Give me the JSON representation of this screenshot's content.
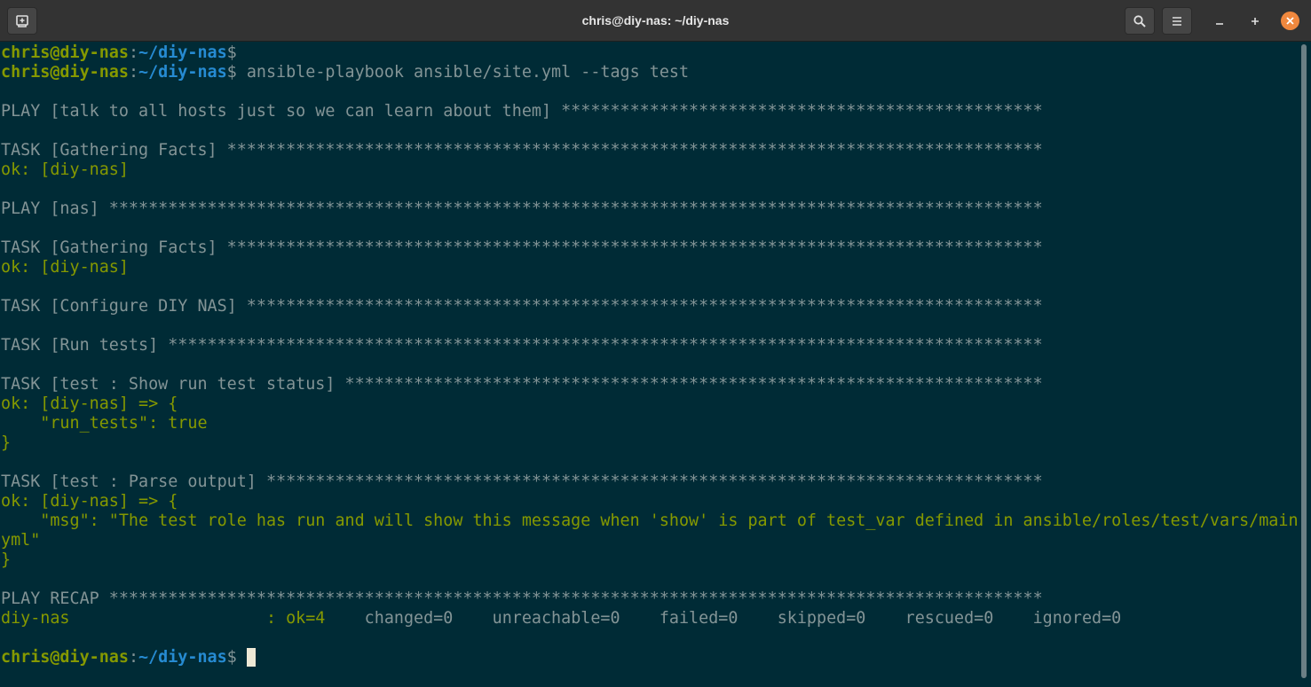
{
  "window": {
    "title": "chris@diy-nas: ~/diy-nas"
  },
  "icons": {
    "new_tab": "new-tab-icon",
    "search": "search-icon",
    "menu": "hamburger-menu-icon",
    "minimize": "minimize-icon",
    "maximize": "maximize-icon",
    "close": "close-icon"
  },
  "colors": {
    "background": "#002b36",
    "prompt_green": "#859900",
    "path_blue": "#268bd2",
    "text_gray": "#839496",
    "close_orange": "#f0883e"
  },
  "prompt": {
    "user_host": "chris@diy-nas",
    "colon": ":",
    "path": "~/diy-nas",
    "dollar": "$"
  },
  "lines": {
    "l1": "",
    "l2_cmd": " ansible-playbook ansible/site.yml --tags test",
    "l3": "",
    "l4": "PLAY [talk to all hosts just so we can learn about them] *************************************************",
    "l5": "",
    "l6": "TASK [Gathering Facts] ***********************************************************************************",
    "l7": "ok: [diy-nas]",
    "l8": "",
    "l9": "PLAY [nas] ***********************************************************************************************",
    "l10": "",
    "l11": "TASK [Gathering Facts] ***********************************************************************************",
    "l12": "ok: [diy-nas]",
    "l13": "",
    "l14": "TASK [Configure DIY NAS] *********************************************************************************",
    "l15": "",
    "l16": "TASK [Run tests] *****************************************************************************************",
    "l17": "",
    "l18": "TASK [test : Show run test status] ***********************************************************************",
    "l19": "ok: [diy-nas] => {",
    "l20": "    \"run_tests\": true",
    "l21": "}",
    "l22": "",
    "l23": "TASK [test : Parse output] *******************************************************************************",
    "l24": "ok: [diy-nas] => {",
    "l25": "    \"msg\": \"The test role has run and will show this message when 'show' is part of test_var defined in ansible/roles/test/vars/main.",
    "l26": "yml\"",
    "l27": "}",
    "l28": "",
    "l29": "PLAY RECAP ***********************************************************************************************",
    "l30_host": "diy-nas                    : ",
    "l30_ok": "ok=4   ",
    "l30_rest": " changed=0    unreachable=0    failed=0    skipped=0    rescued=0    ignored=0",
    "l31": ""
  }
}
